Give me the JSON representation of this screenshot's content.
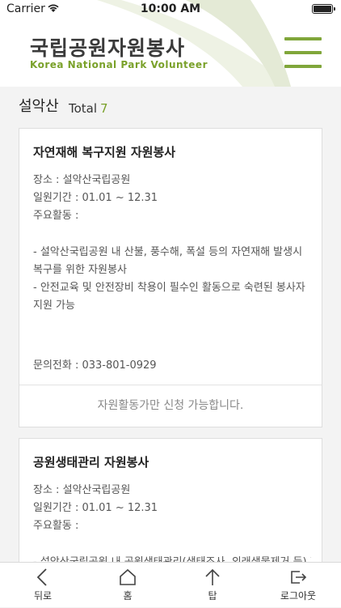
{
  "status_bar": {
    "carrier": "Carrier",
    "time": "10:00 AM"
  },
  "header": {
    "title_ko": "국립공원자원봉사",
    "title_en": "Korea National Park Volunteer",
    "menu_icon": "hamburger-menu-icon"
  },
  "region": {
    "name": "설악산",
    "total_label": "Total",
    "total_count": "7"
  },
  "cards": [
    {
      "title": "자연재해 복구지원 자원봉사",
      "place": "장소 : 설악산국립공원",
      "period": "일원기간 : 01.01 ~ 12.31",
      "activity_label": "주요활동 :",
      "description": [
        "- 설악산국립공원 내 산불, 풍수해, 폭설 등의 자연재해 발생시",
        "복구를 위한 자원봉사",
        "- 안전교육 및 안전장비 착용이 필수인 활동으로 숙련된 봉사자",
        "지원 가능"
      ],
      "phone": "문의전화 : 033-801-0929",
      "footer": "자원활동가만 신청 가능합니다."
    },
    {
      "title": "공원생태관리 자원봉사",
      "place": "장소 : 설악산국립공원",
      "period": "일원기간 : 01.01 ~ 12.31",
      "activity_label": "주요활동 :",
      "description": [
        "- 설악산국립공원 내 공원생태관리(생태조사, 외래생물제거 등) 지"
      ]
    }
  ],
  "tabbar": [
    {
      "label": "뒤로",
      "icon": "back-arrow-icon"
    },
    {
      "label": "홈",
      "icon": "home-icon"
    },
    {
      "label": "탑",
      "icon": "scroll-top-icon"
    },
    {
      "label": "로그아웃",
      "icon": "logout-icon"
    }
  ],
  "colors": {
    "accent": "#7aa12a",
    "menu": "#80a63a",
    "background": "#f3f3f3"
  }
}
